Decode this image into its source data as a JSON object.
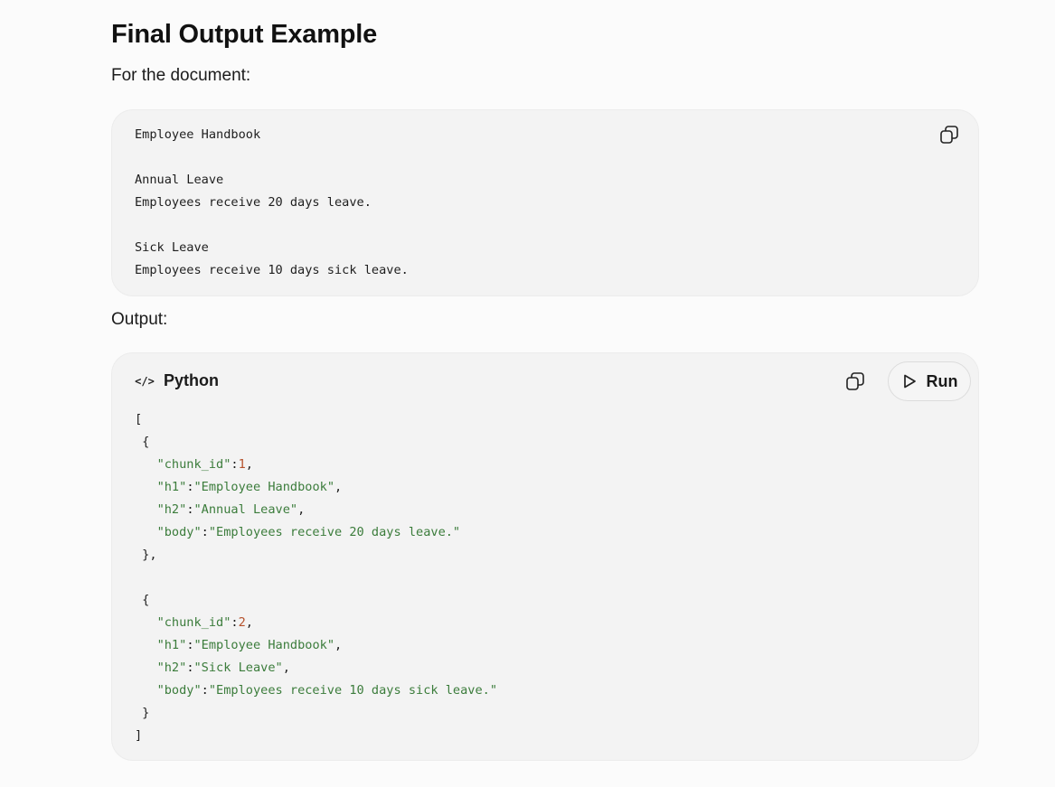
{
  "section": {
    "title": "Final Output Example",
    "intro_text": "For the document:",
    "output_text": "Output:"
  },
  "document_block": {
    "lines": [
      "Employee Handbook",
      "",
      "Annual Leave",
      "Employees receive 20 days leave.",
      "",
      "Sick Leave",
      "Employees receive 10 days sick leave."
    ],
    "copy_icon": "copy-icon"
  },
  "output_block": {
    "language": "Python",
    "lang_icon": "</>",
    "run_label": "Run",
    "copy_icon": "copy-icon",
    "play_icon": "play-icon",
    "chunks": [
      {
        "chunk_id": "1",
        "h1": "\"Employee Handbook\"",
        "h2": "\"Annual Leave\"",
        "body": "\"Employees receive 20 days leave.\""
      },
      {
        "chunk_id": "2",
        "h1": "\"Employee Handbook\"",
        "h2": "\"Sick Leave\"",
        "body": "\"Employees receive 10 days sick leave.\""
      }
    ],
    "keys": {
      "chunk_id": "\"chunk_id\"",
      "h1": "\"h1\"",
      "h2": "\"h2\"",
      "body": "\"body\""
    }
  },
  "colors": {
    "string": "#3b7c3b",
    "number": "#b5502a",
    "code_background": "#f3f3f3"
  }
}
